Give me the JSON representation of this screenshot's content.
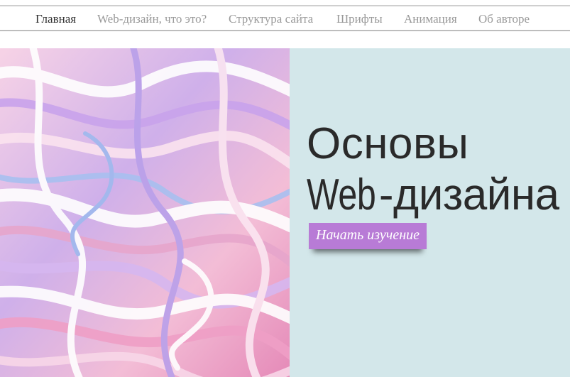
{
  "nav": {
    "items": [
      {
        "label": "Главная",
        "active": true
      },
      {
        "label": "Web-дизайн, что это?",
        "active": false
      },
      {
        "label": "Структура сайта",
        "active": false
      },
      {
        "label": "Шрифты",
        "active": false
      },
      {
        "label": "Анимация",
        "active": false
      },
      {
        "label": "Об авторе",
        "active": false
      }
    ]
  },
  "hero": {
    "title_line1": "Основы",
    "title_line2_a": "Web",
    "title_line2_b": "-дизайна",
    "cta_label": "Начать изучение"
  },
  "colors": {
    "hero_background": "#d3e7ea",
    "cta_background": "#b87bd6",
    "nav_active": "#333333",
    "nav_inactive": "#9a9a9a"
  }
}
